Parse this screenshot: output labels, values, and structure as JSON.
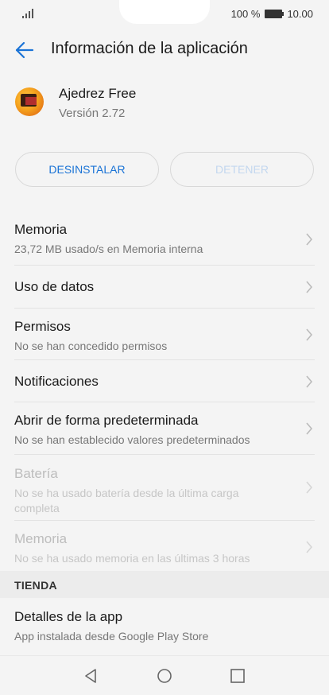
{
  "status_bar": {
    "battery_percent": "100 %",
    "time": "10.00",
    "signal_icon": "signal-icon",
    "battery_icon": "battery-icon"
  },
  "header": {
    "title": "Información de la aplicación",
    "back_icon": "back-arrow-icon"
  },
  "app": {
    "name": "Ajedrez Free",
    "version": "Versión 2.72",
    "icon": "app-icon"
  },
  "buttons": {
    "uninstall": "DESINSTALAR",
    "stop": "DETENER"
  },
  "items": [
    {
      "title": "Memoria",
      "subtitle": "23,72 MB usado/s en Memoria interna",
      "enabled": true
    },
    {
      "title": "Uso de datos",
      "subtitle": "",
      "enabled": true
    },
    {
      "title": "Permisos",
      "subtitle": "No se han concedido permisos",
      "enabled": true
    },
    {
      "title": "Notificaciones",
      "subtitle": "",
      "enabled": true
    },
    {
      "title": "Abrir de forma predeterminada",
      "subtitle": "No se han establecido valores predeterminados",
      "enabled": true
    },
    {
      "title": "Batería",
      "subtitle": "No se ha usado batería desde la última carga completa",
      "enabled": false
    },
    {
      "title": "Memoria",
      "subtitle": "No se ha usado memoria en las últimas 3 horas",
      "enabled": false
    }
  ],
  "store_section": {
    "header": "TIENDA",
    "items": [
      {
        "title": "Detalles de la app",
        "subtitle": "App instalada desde Google Play Store"
      }
    ]
  },
  "colors": {
    "accent": "#1a73d6",
    "background": "#f4f4f4",
    "disabled_text": "#bdbdbd"
  },
  "nav_bar": {
    "back_icon": "nav-back-icon",
    "home_icon": "nav-home-icon",
    "recents_icon": "nav-recents-icon"
  }
}
